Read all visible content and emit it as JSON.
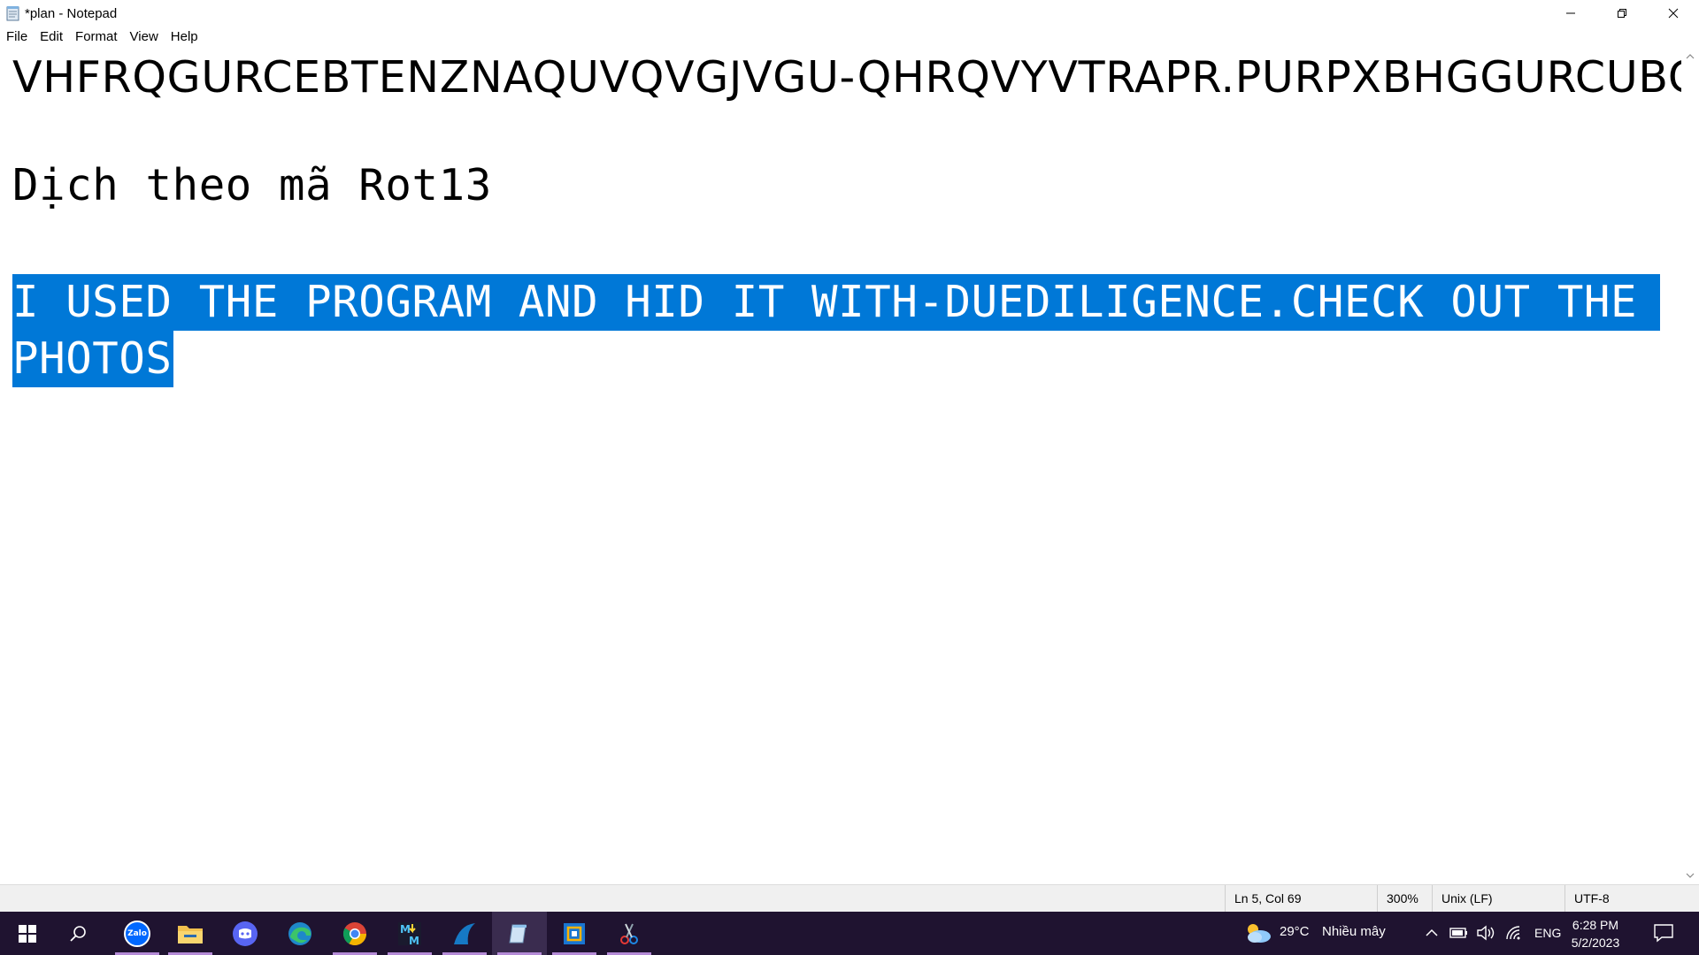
{
  "window": {
    "title": "*plan - Notepad",
    "icon": "notepad-icon",
    "controls": [
      "minimize-icon",
      "restore-icon",
      "close-icon"
    ]
  },
  "menu": {
    "items": [
      {
        "label": "File"
      },
      {
        "label": "Edit"
      },
      {
        "label": "Format"
      },
      {
        "label": "View"
      },
      {
        "label": "Help"
      }
    ]
  },
  "editor": {
    "line1": "VHFRQGURCEBTENZNAQUVQVGJVGU-QHRQVYVTRAPR.PURPXBHGGURCUBGBF",
    "line3": "Dịch theo mã Rot13",
    "selected_line1": "I USED THE PROGRAM AND HID IT WITH-DUEDILIGENCE.CHECK OUT THE",
    "selected_line2": "PHOTOS",
    "selection_color": "#0078d7"
  },
  "status": {
    "position": "Ln 5, Col 69",
    "zoom": "300%",
    "line_ending": "Unix (LF)",
    "encoding": "UTF-8"
  },
  "taskbar": {
    "apps": [
      {
        "name": "start-icon"
      },
      {
        "name": "search-icon"
      },
      {
        "name": "zalo-icon",
        "label": "Zalo"
      },
      {
        "name": "file-explorer-icon"
      },
      {
        "name": "discord-icon"
      },
      {
        "name": "edge-icon"
      },
      {
        "name": "chrome-icon"
      },
      {
        "name": "mm-app-icon"
      },
      {
        "name": "wireshark-icon"
      },
      {
        "name": "notepad-icon",
        "active": true
      },
      {
        "name": "virtualbox-icon"
      },
      {
        "name": "snipping-tool-icon"
      }
    ],
    "weather": {
      "temp": "29°C",
      "desc": "Nhiều mây"
    },
    "language": "ENG",
    "time": "6:28 PM",
    "date": "5/2/2023"
  },
  "colors": {
    "taskbar_bg": "#1f1330",
    "selection": "#0078d7",
    "statusbar_bg": "#f0f0f0"
  }
}
